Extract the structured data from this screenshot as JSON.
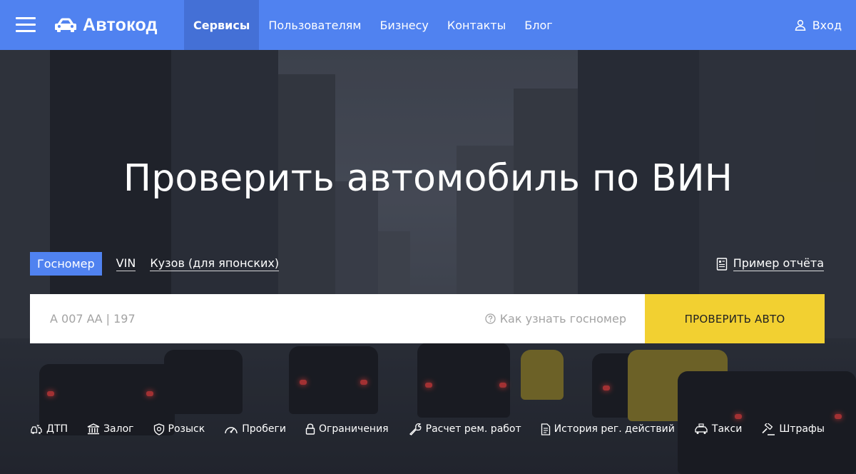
{
  "header": {
    "logo_text": "Автокод",
    "nav": [
      {
        "label": "Сервисы",
        "active": true
      },
      {
        "label": "Пользователям",
        "active": false
      },
      {
        "label": "Бизнесу",
        "active": false
      },
      {
        "label": "Контакты",
        "active": false
      },
      {
        "label": "Блог",
        "active": false
      }
    ],
    "login_label": "Вход"
  },
  "hero": {
    "title": "Проверить автомобиль по ВИН",
    "tabs": [
      {
        "label": "Госномер",
        "active": true
      },
      {
        "label": "VIN",
        "active": false
      },
      {
        "label": "Кузов (для японских)",
        "active": false
      }
    ],
    "sample_report_label": "Пример отчёта",
    "search": {
      "placeholder": "А 007 АА | 197",
      "value": "",
      "hint_label": "Как узнать госномер",
      "button_label": "ПРОВЕРИТЬ АВТО"
    }
  },
  "services": [
    {
      "label": "ДТП",
      "icon": "crash-icon"
    },
    {
      "label": "Залог",
      "icon": "bank-icon"
    },
    {
      "label": "Розыск",
      "icon": "badge-icon"
    },
    {
      "label": "Пробеги",
      "icon": "speedometer-icon"
    },
    {
      "label": "Ограничения",
      "icon": "lock-icon"
    },
    {
      "label": "Расчет рем. работ",
      "icon": "wrench-icon"
    },
    {
      "label": "История рег. действий",
      "icon": "document-icon"
    },
    {
      "label": "Такси",
      "icon": "taxi-icon"
    },
    {
      "label": "Штрафы",
      "icon": "gavel-icon"
    }
  ],
  "colors": {
    "header_bg": "#5082f0",
    "nav_active_bg": "#4470d6",
    "button_bg": "#f2d031"
  }
}
